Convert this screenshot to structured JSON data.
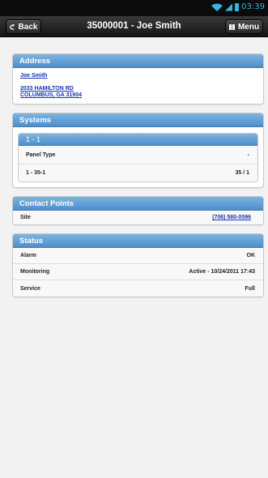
{
  "status_bar": {
    "time": "03:39"
  },
  "nav": {
    "back_label": "Back",
    "title": "35000001 - Joe Smith",
    "menu_label": "Menu"
  },
  "address": {
    "header": "Address",
    "name": "Joe Smith",
    "line1": "2033 HAMILTON RD",
    "line2": "COLUMBUS, GA 31904"
  },
  "systems": {
    "header": "Systems",
    "sub_header": "1 - 1",
    "rows": [
      {
        "label": "Panel Type",
        "value": "-"
      },
      {
        "label": "1 - 35-1",
        "value": "35 / 1"
      }
    ]
  },
  "contact_points": {
    "header": "Contact Points",
    "rows": [
      {
        "label": "Site",
        "value": "(706) 580-0596"
      }
    ]
  },
  "status": {
    "header": "Status",
    "rows": [
      {
        "label": "Alarm",
        "value": "OK"
      },
      {
        "label": "Monitoring",
        "value": "Active - 10/24/2011 17:43"
      },
      {
        "label": "Service",
        "value": "Full"
      }
    ]
  }
}
